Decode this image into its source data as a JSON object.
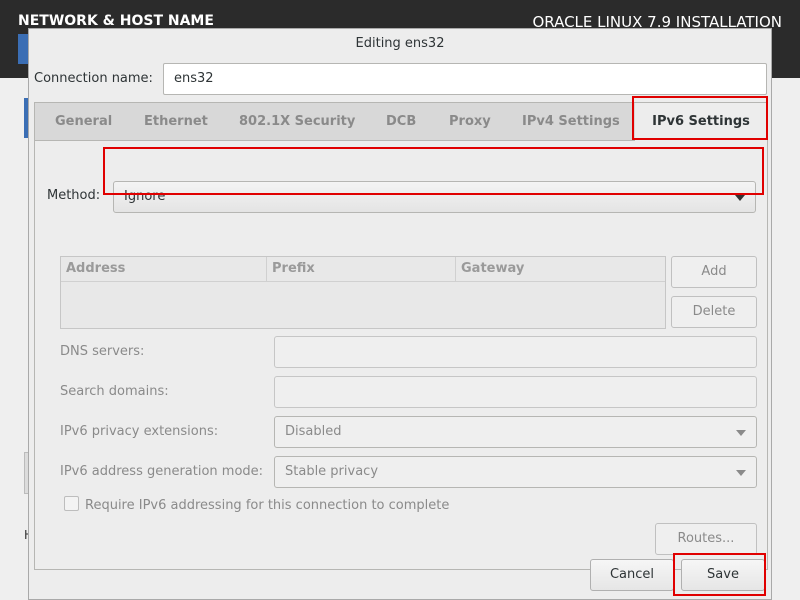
{
  "background": {
    "left_title": "NETWORK & HOST NAME",
    "right_title": "ORACLE LINUX 7.9 INSTALLATION"
  },
  "dialog": {
    "title": "Editing ens32",
    "connection_name_label": "Connection name:",
    "connection_name_value": "ens32",
    "tabs": [
      "General",
      "Ethernet",
      "802.1X Security",
      "DCB",
      "Proxy",
      "IPv4 Settings",
      "IPv6 Settings"
    ],
    "active_tab": "IPv6 Settings",
    "method_label": "Method:",
    "method_value": "Ignore",
    "address_columns": [
      "Address",
      "Prefix",
      "Gateway"
    ],
    "add_button": "Add",
    "delete_button": "Delete",
    "dns_label": "DNS servers:",
    "dns_value": "",
    "search_domains_label": "Search domains:",
    "search_domains_value": "",
    "privacy_label": "IPv6 privacy extensions:",
    "privacy_value": "Disabled",
    "addr_gen_label": "IPv6 address generation mode:",
    "addr_gen_value": "Stable privacy",
    "require_checkbox_label": "Require IPv6 addressing for this connection to complete",
    "require_checkbox_checked": false,
    "routes_button": "Routes...",
    "cancel_button": "Cancel",
    "save_button": "Save"
  },
  "colors": {
    "highlight": "#e00000",
    "accent_blue": "#3b6eb4"
  }
}
